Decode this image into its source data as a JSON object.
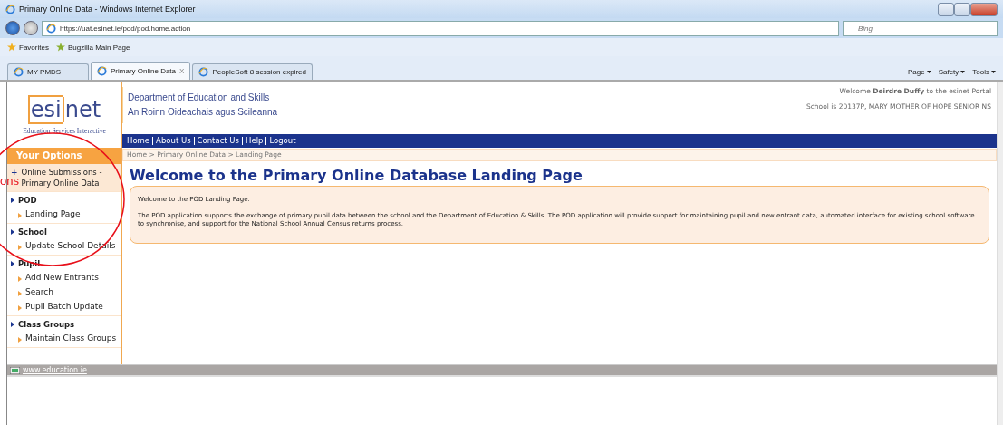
{
  "window": {
    "title": "Primary Online Data - Windows Internet Explorer"
  },
  "address_bar": {
    "url": "https://uat.esinet.ie/pod/pod.home.action",
    "search_placeholder": "Bing"
  },
  "favorites_bar": {
    "items": [
      {
        "label": "Favorites"
      },
      {
        "label": "Bugzilla Main Page"
      }
    ]
  },
  "tabs": [
    {
      "label": "MY PMDS",
      "selected": false
    },
    {
      "label": "Primary Online Data",
      "selected": true,
      "close": "X"
    },
    {
      "label": "PeopleSoft 8 session expired",
      "selected": false
    }
  ],
  "command_bar": [
    "Page",
    "Safety",
    "Tools"
  ],
  "page": {
    "logo": {
      "word_left": "esi",
      "word_right": "net",
      "tagline": "Education Services Interactive"
    },
    "department": [
      "Department of Education and Skills",
      "An Roinn Oideachais agus Scileanna"
    ],
    "welcome": "Welcome **Deirdre Duffy** to the esinet Portal",
    "school": "School is 20137P, MARY MOTHER OF HOPE SENIOR NS",
    "nav": [
      "Home",
      "About Us",
      "Contact Us",
      "Help",
      "Logout"
    ],
    "breadcrumb": "Home > Primary Online Data > Landing Page",
    "heading": "Welcome to the Primary Online Database Landing Page",
    "intro": "Welcome to the POD Landing Page.",
    "body": "The POD application supports the exchange of primary pupil data between the school and the Department of Education & Skills. The POD application will provide support for maintaining pupil and new entrant data, automated interface for existing school software to synchronise, and support for the National School Annual Census returns process.",
    "sidebar": {
      "title": "Your Options",
      "items": [
        {
          "label": "Online Submissions - Primary Online Data",
          "marker": "+"
        },
        {
          "label": "POD",
          "children": [
            {
              "label": "Landing Page"
            }
          ]
        },
        {
          "label": "School",
          "children": [
            {
              "label": "Update School Details"
            }
          ]
        },
        {
          "label": "Pupil",
          "children": [
            {
              "label": "Add New Entrants"
            },
            {
              "label": "Search"
            },
            {
              "label": "Pupil Batch Update"
            }
          ]
        },
        {
          "label": "Class Groups",
          "children": [
            {
              "label": "Maintain Class Groups"
            }
          ]
        }
      ]
    },
    "footer_link": "www.education.ie"
  },
  "annotation": {
    "text": "ons"
  }
}
